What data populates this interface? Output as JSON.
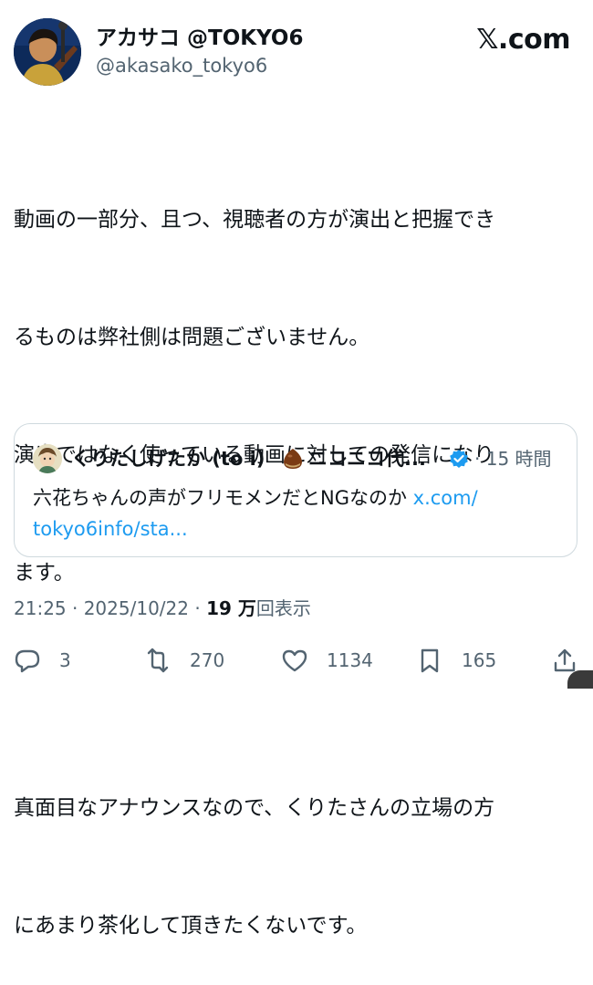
{
  "author": {
    "display_name": "アカサコ @TOKYO6",
    "handle": "@akasako_tokyo6"
  },
  "site_logo": "𝕏.com",
  "post": {
    "lines": [
      "動画の一部分、且つ、視聴者の方が演出と把握でき",
      "るものは弊社側は問題ございません。",
      "演出ではなく使っている動画に対しての発信になり",
      "ます。",
      "",
      "真面目なアナウンスなので、くりたさんの立場の方",
      "にあまり茶化して頂きたくないです。"
    ]
  },
  "quote": {
    "name": "くりたしげたか (to i)",
    "name_suffix": "ニコニコ代...",
    "time": "· 15 時間",
    "text": "六花ちゃんの声がフリモメンだとNGなのか ",
    "link_line1": "x.com/",
    "link_line2": "tokyo6info/sta..."
  },
  "meta": {
    "time": "21:25 · 2025/10/22 · ",
    "views_count": "19 万",
    "views_label": "回表示"
  },
  "actions": {
    "replies": "3",
    "reposts": "270",
    "likes": "1134",
    "bookmarks": "165"
  },
  "colors": {
    "text": "#0f1419",
    "secondary": "#536471",
    "link": "#1d9bf0",
    "border": "#cfd9de"
  },
  "icons": [
    "reply-icon",
    "repost-icon",
    "like-icon",
    "bookmark-icon",
    "share-icon",
    "verified-icon",
    "chestnut-emoji"
  ]
}
